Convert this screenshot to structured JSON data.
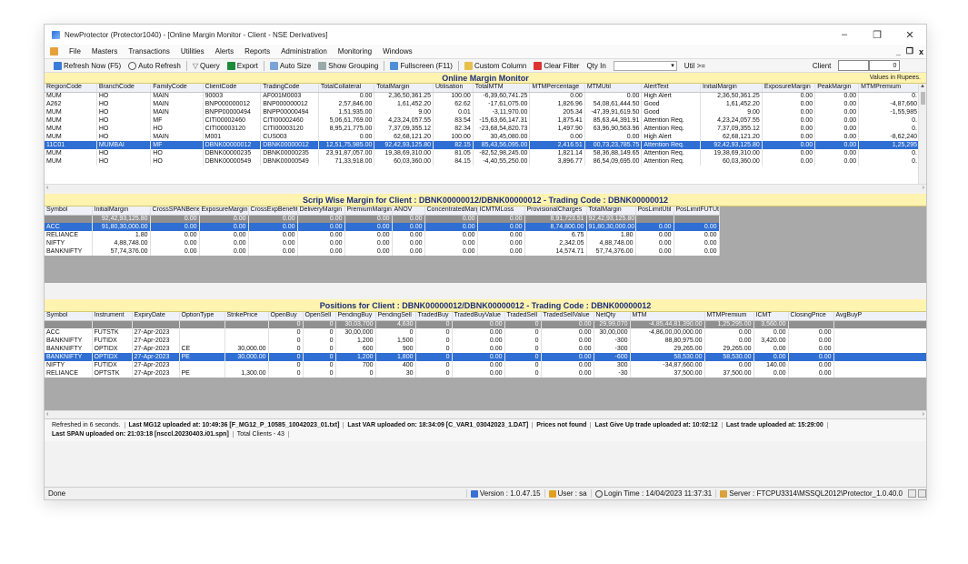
{
  "window": {
    "title": "NewProtector (Protector1040) - [Online Margin Monitor - Client - NSE Derivatives]",
    "minimize": "–",
    "restore": "❐",
    "close": "✕"
  },
  "menu": {
    "items": [
      "File",
      "Masters",
      "Transactions",
      "Utilities",
      "Alerts",
      "Reports",
      "Administration",
      "Monitoring",
      "Windows"
    ],
    "mdi_min": "_",
    "mdi_restore": "❐",
    "mdi_close": "x"
  },
  "toolbar": {
    "refresh_now": "Refresh Now (F5)",
    "auto_refresh": "Auto Refresh",
    "query": "Query",
    "export": "Export",
    "auto_size": "Auto Size",
    "show_grouping": "Show Grouping",
    "fullscreen": "Fullscreen (F11)",
    "custom_column": "Custom Column",
    "clear_filter": "Clear Filter",
    "qty_in": "Qty In",
    "util_label": "Util >=",
    "client_label": "Client",
    "client_value": "0"
  },
  "monitor": {
    "title": "Online Margin Monitor",
    "values_note": "Values in Rupees.",
    "columns": [
      "RegionCode",
      "BranchCode",
      "FamilyCode",
      "ClientCode",
      "TradingCode",
      "TotalCollateral",
      "TotalMargin",
      "Utilisation",
      "TotalMTM",
      "MTMPercentage",
      "MTMUtil",
      "AlertText",
      "InitialMargin",
      "ExposureMargin",
      "PeakMargin",
      "MTMPremium"
    ],
    "rows": [
      [
        "MUM",
        "HO",
        "MAIN",
        "90003",
        "AF001M0003",
        "0.00",
        "2,36,50,361.25",
        "100.00",
        "-6,39,60,741.25",
        "0.00",
        "0.00",
        "High Alert",
        "2,36,50,361.25",
        "0.00",
        "0.00",
        "0."
      ],
      [
        "A262",
        "HO",
        "MAIN",
        "BNP000000012",
        "BNP000000012",
        "2,57,846.00",
        "1,61,452.20",
        "62.62",
        "-17,61,075.00",
        "1,826.96",
        "54,08,61,444.50",
        "Good",
        "1,61,452.20",
        "0.00",
        "0.00",
        "-4,87,660"
      ],
      [
        "MUM",
        "HO",
        "MAIN",
        "BNPP00000494",
        "BNPP00000494",
        "1,51,935.00",
        "9.00",
        "0.01",
        "-3,11,970.00",
        "205.34",
        "-47,39,91,619.50",
        "Good",
        "9.00",
        "0.00",
        "0.00",
        "-1,55,985"
      ],
      [
        "MUM",
        "HO",
        "MF",
        "CITI00002460",
        "CITI00002460",
        "5,06,61,769.00",
        "4,23,24,057.55",
        "83.54",
        "-15,63,66,147.31",
        "1,875.41",
        "85,63,44,391.91",
        "Attention Req.",
        "4,23,24,057.55",
        "0.00",
        "0.00",
        "0."
      ],
      [
        "MUM",
        "HO",
        "HO",
        "CITI00003120",
        "CITI00003120",
        "8,95,21,775.00",
        "7,37,09,355.12",
        "82.34",
        "-23,68,54,820.73",
        "1,497.90",
        "63,96,90,563.96",
        "Attention Req.",
        "7,37,09,355.12",
        "0.00",
        "0.00",
        "0."
      ],
      [
        "MUM",
        "HO",
        "MAIN",
        "M001",
        "CUS003",
        "0.00",
        "62,68,121.20",
        "100.00",
        "30,45,080.00",
        "0.00",
        "0.00",
        "High Alert",
        "62,68,121.20",
        "0.00",
        "0.00",
        "-8,62,240"
      ],
      [
        "11C01",
        "MUMBAI",
        "MF",
        "DBNK00000012",
        "DBNK00000012",
        "12,51,75,985.00",
        "92,42,93,125.80",
        "82.15",
        "85,43,56,095.00",
        "2,416.51",
        "00,73,23,785.75",
        "Attention Req.",
        "92,42,93,125.80",
        "0.00",
        "0.00",
        "1,25,295"
      ],
      [
        "MUM",
        "HO",
        "HO",
        "DBNK00000235",
        "DBNK00000235",
        "23,91,87,057.00",
        "19,38,69,310.00",
        "81.05",
        "-82,52,98,245.00",
        "1,821.14",
        "58,36,88,149.65",
        "Attention Req.",
        "19,38,69,310.00",
        "0.00",
        "0.00",
        "0."
      ],
      [
        "MUM",
        "HO",
        "HO",
        "DBNK00000549",
        "DBNK00000549",
        "71,33,918.00",
        "60,03,360.00",
        "84.15",
        "-4,40,55,250.00",
        "3,896.77",
        "86,54,09,695.00",
        "Attention Req.",
        "60,03,360.00",
        "0.00",
        "0.00",
        "0."
      ]
    ],
    "selected_row": 6
  },
  "scrip": {
    "title": "Scrip Wise Margin for Client : DBNK00000012/DBNK00000012 - Trading Code : DBNK00000012",
    "columns": [
      "Symbol",
      "InitialMargin",
      "CrossSPANBenefit",
      "ExposureMargin",
      "CrossExpBenefit",
      "DeliveryMargin",
      "PremiumMargin",
      "ANOV",
      "ConcentratedMargin",
      "ICMTMLoss",
      "ProvisionalCharges",
      "TotalMargin",
      "PosLimitUtil",
      "PosLimitFUTUtil"
    ],
    "total_row": [
      "",
      "92,42,93,125.80",
      "0.00",
      "0.00",
      "0.00",
      "0.00",
      "0.00",
      "0.00",
      "0.00",
      "0.00",
      "8,91,723.51",
      "92,42,93,125.80",
      "",
      ""
    ],
    "rows": [
      [
        "ACC",
        "91,80,30,000.00",
        "0.00",
        "0.00",
        "0.00",
        "0.00",
        "0.00",
        "0.00",
        "0.00",
        "0.00",
        "8,74,800.00",
        "91,80,30,000.00",
        "0.00",
        "0.00"
      ],
      [
        "RELIANCE",
        "1.80",
        "0.00",
        "0.00",
        "0.00",
        "0.00",
        "0.00",
        "0.00",
        "0.00",
        "0.00",
        "6.75",
        "1.80",
        "0.00",
        "0.00"
      ],
      [
        "NIFTY",
        "4,88,748.00",
        "0.00",
        "0.00",
        "0.00",
        "0.00",
        "0.00",
        "0.00",
        "0.00",
        "0.00",
        "2,342.05",
        "4,88,748.00",
        "0.00",
        "0.00"
      ],
      [
        "BANKNIFTY",
        "57,74,376.00",
        "0.00",
        "0.00",
        "0.00",
        "0.00",
        "0.00",
        "0.00",
        "0.00",
        "0.00",
        "14,574.71",
        "57,74,376.00",
        "0.00",
        "0.00"
      ]
    ],
    "selected_row": 0
  },
  "positions": {
    "title": "Positions for Client : DBNK00000012/DBNK00000012 - Trading Code : DBNK00000012",
    "columns": [
      "Symbol",
      "Instrument",
      "ExpiryDate",
      "OptionType",
      "StrikePrice",
      "OpenBuy",
      "OpenSell",
      "PendingBuy",
      "PendingSell",
      "TradedBuy",
      "TradedBuyValue",
      "TradedSell",
      "TradedSellValue",
      "NetQty",
      "MTM",
      "MTMPremium",
      "ICMT",
      "ClosingPrice",
      "AvgBuyP"
    ],
    "total_row": [
      "",
      "",
      "",
      "",
      "",
      "0",
      "0",
      "30,03,700",
      "4,630",
      "0",
      "0.00",
      "0",
      "0.00",
      "29,99,070",
      "-4,85,44,81,390.00",
      "1,25,295.00",
      "3,560.00",
      "",
      ""
    ],
    "rows": [
      [
        "ACC",
        "FUTSTK",
        "27-Apr-2023",
        "",
        "",
        "0",
        "0",
        "30,00,000",
        "0",
        "0",
        "0.00",
        "0",
        "0.00",
        "30,00,000",
        "-4,86,00,00,000.00",
        "0.00",
        "0.00",
        "0.00",
        ""
      ],
      [
        "BANKNIFTY",
        "FUTIDX",
        "27-Apr-2023",
        "",
        "",
        "0",
        "0",
        "1,200",
        "1,500",
        "0",
        "0.00",
        "0",
        "0.00",
        "-300",
        "88,80,975.00",
        "0.00",
        "3,420.00",
        "0.00",
        ""
      ],
      [
        "BANKNIFTY",
        "OPTIDX",
        "27-Apr-2023",
        "CE",
        "30,000.00",
        "0",
        "0",
        "600",
        "900",
        "0",
        "0.00",
        "0",
        "0.00",
        "-300",
        "29,265.00",
        "29,265.00",
        "0.00",
        "0.00",
        ""
      ],
      [
        "BANKNIFTY",
        "OPTIDX",
        "27-Apr-2023",
        "PE",
        "30,000.00",
        "0",
        "0",
        "1,200",
        "1,800",
        "0",
        "0.00",
        "0",
        "0.00",
        "-600",
        "58,530.00",
        "58,530.00",
        "0.00",
        "0.00",
        ""
      ],
      [
        "NIFTY",
        "FUTIDX",
        "27-Apr-2023",
        "",
        "",
        "0",
        "0",
        "700",
        "400",
        "0",
        "0.00",
        "0",
        "0.00",
        "300",
        "-34,87,660.00",
        "0.00",
        "140.00",
        "0.00",
        ""
      ],
      [
        "RELIANCE",
        "OPTSTK",
        "27-Apr-2023",
        "PE",
        "1,300.00",
        "0",
        "0",
        "0",
        "30",
        "0",
        "0.00",
        "0",
        "0.00",
        "-30",
        "37,500.00",
        "37,500.00",
        "0.00",
        "0.00",
        ""
      ]
    ],
    "selected_row": 3
  },
  "status": {
    "refreshed": "Refreshed in 6 seconds.",
    "mg12": "Last MG12 uploaded at: 10:49:36 [F_MG12_P_10585_10042023_01.txt]",
    "var": "Last VAR uploaded on: 18:34:09 [C_VAR1_03042023_1.DAT]",
    "prices": "Prices not found",
    "giveup": "Last Give Up trade uploaded at: 10:02:12",
    "last_trade": "Last trade uploaded at: 15:29:00",
    "span": "Last SPAN uploaded on: 21:03:18 [nsccl.20230403.i01.spn]",
    "clients": "Total Clients - 43"
  },
  "bottom": {
    "done": "Done",
    "version": "Version : 1.0.47.15",
    "user": "User : sa",
    "login": "Login Time : 14/04/2023 11:37:31",
    "server": "Server : FTCPU3314\\MSSQL2012\\Protector_1.0.40.0"
  }
}
